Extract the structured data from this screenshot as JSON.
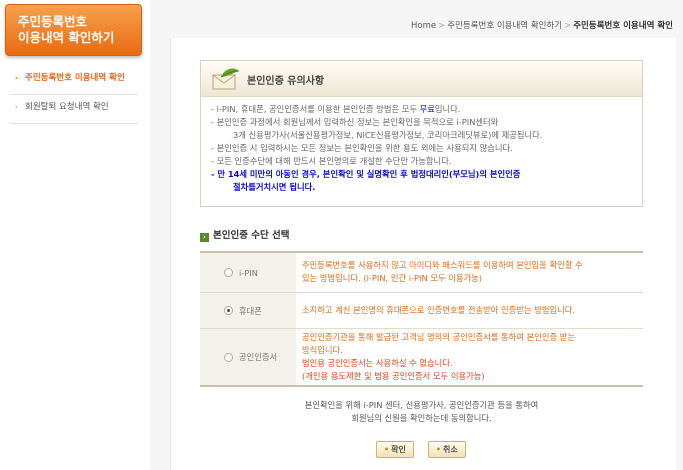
{
  "sidebar": {
    "title_line1": "주민등록번호",
    "title_line2": "이용내역 확인하기",
    "items": [
      {
        "label": "주민등록번호 이용내역 확인",
        "active": true
      },
      {
        "label": "회원탈퇴 요청내역 확인",
        "active": false
      }
    ]
  },
  "breadcrumb": {
    "home": "Home",
    "level1": "주민등록번호 이용내역 확인하기",
    "current": "주민등록번호 이용내역 확인"
  },
  "notice": {
    "title": "본인인증 유의사항",
    "line1_pre": "- i-PIN, 휴대폰, 공인인증서를 이용한 본인인증 방법은 모두 ",
    "line1_free": "무료",
    "line1_post": "입니다.",
    "line2": "- 본인인증 과정에서 회원님께서 입력하신 정보는 본인확인을 목적으로 i-PIN센터와",
    "line3": "3개 신용평가사(서울신용평가정보, NICE신용평가정보, 코리아크레딧뷰로)에 제공됩니다.",
    "line4": "- 본인인증 시 입력하시는 모든 정보는 본인확인을 위한 용도 외에는 사용되지 않습니다.",
    "line5": "- 모든 인증수단에 대해 반드시 본인명의로 개설한 수단만 가능합니다.",
    "line6": "- 만 14세 미만의 아동인 경우, 본인확인 및 실명확인 후 법정대리인(부모님)의 본인인증",
    "line7": "절차를거치시면 됩니다."
  },
  "section": {
    "title": "본인인증 수단 선택"
  },
  "options": [
    {
      "label": "i-PIN",
      "selected": false,
      "desc1": "주민등록번호를 사용하지 않고 아이디와 패스워드를 이용하여 본인임을 확인할 수",
      "desc2": "있는 방법입니다. ",
      "desc2_note": "(i-PIN, 민간 i-PIN 모두 이용가능)"
    },
    {
      "label": "휴대폰",
      "selected": true,
      "desc1": "소지하고 계신 본인명의 휴대폰으로 인증번호를 전송받아 인증받는 방법입니다."
    },
    {
      "label": "공인인증서",
      "selected": false,
      "desc1": "공인인증기관을 통해 발급된 고객님 명의의 공인인증서를 통하여 본인인증 받는",
      "desc2": "방식입니다.",
      "desc3": "법인용 공인인증서는 사용하실 수 없습니다.",
      "desc4": "(개인용 용도제한 및 범용 공인인증서 모두 이용가능)"
    }
  ],
  "footer": {
    "line1": "본인확인을 위해 i-PIN 센터, 신용평가사, 공인인증기관 등을 통하여",
    "line2": "회원님의 신원을 확인하는데 동의합니다."
  },
  "buttons": {
    "confirm": "확인",
    "cancel": "취소"
  },
  "colors": {
    "accent": "#e96b10",
    "notice_blue": "#0b0bd0",
    "desc_orange": "#e06a16"
  }
}
